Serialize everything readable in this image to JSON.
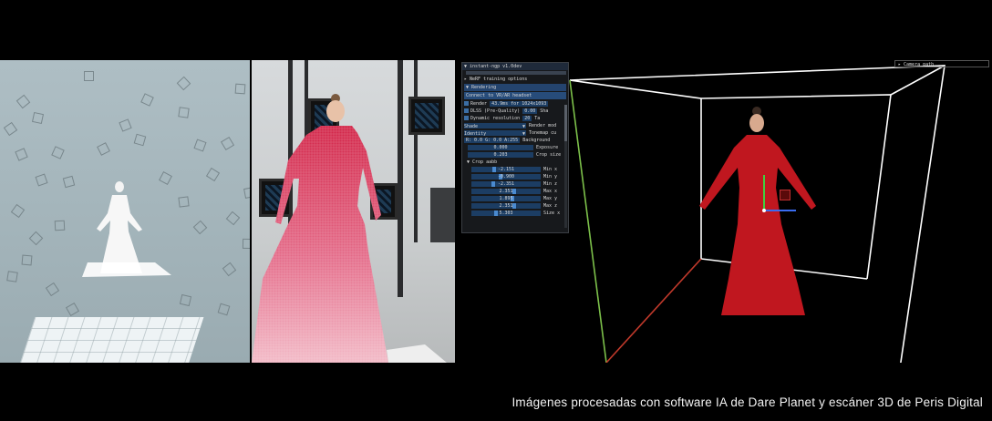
{
  "caption": "Imágenes procesadas con software IA de Dare Planet y escáner 3D de Peris Digital",
  "viewer": {
    "window_title": "instant-ngp v1.0dev",
    "camera_path_label": "Camera path",
    "colors": {
      "box_edge": "#ffffff",
      "axis_x": "#c0392b",
      "axis_y": "#7cc04a",
      "gizmo_green": "#3fcf3f",
      "gizmo_blue": "#3a6cf0",
      "dress_red": "#c0171f"
    },
    "settings": {
      "rows": [
        {
          "type": "section-collapsed",
          "label": "NeRF training options"
        },
        {
          "type": "section",
          "label": "Rendering"
        },
        {
          "type": "button",
          "label": "Connect to VR/AR headset"
        },
        {
          "type": "check",
          "label": "Render",
          "value": "43.9ms for 1024x1093"
        },
        {
          "type": "check",
          "label": "DLSS (Pre-Quality)",
          "value": "0.00",
          "suffix": "Sha"
        },
        {
          "type": "check",
          "label": "Dynamic resolution",
          "value": "20",
          "suffix": "Ta"
        },
        {
          "type": "combo",
          "value": "Shade",
          "label": "Render mod"
        },
        {
          "type": "combo",
          "value": "Identity",
          "label": "Tonemap cu"
        },
        {
          "type": "triple",
          "value": "R: 0.0 G: 0.0 A:255",
          "label": "Background"
        },
        {
          "type": "field",
          "value": "0.000",
          "label": "Exposure"
        },
        {
          "type": "field",
          "value": "0.203",
          "label": "Crop size"
        },
        {
          "type": "subsection",
          "label": "Crop aabb"
        }
      ],
      "crop": [
        {
          "value": "-2.151",
          "label": "Min x",
          "knob": 0.32
        },
        {
          "value": "-0.900",
          "label": "Min y",
          "knob": 0.42
        },
        {
          "value": "-2.351",
          "label": "Min z",
          "knob": 0.3
        },
        {
          "value": "2.351",
          "label": "Max x",
          "knob": 0.62
        },
        {
          "value": "1.895",
          "label": "Max y",
          "knob": 0.6
        },
        {
          "value": "2.351",
          "label": "Max z",
          "knob": 0.62
        },
        {
          "value": "5.303",
          "label": "Size x",
          "knob": 0.35
        }
      ]
    }
  }
}
